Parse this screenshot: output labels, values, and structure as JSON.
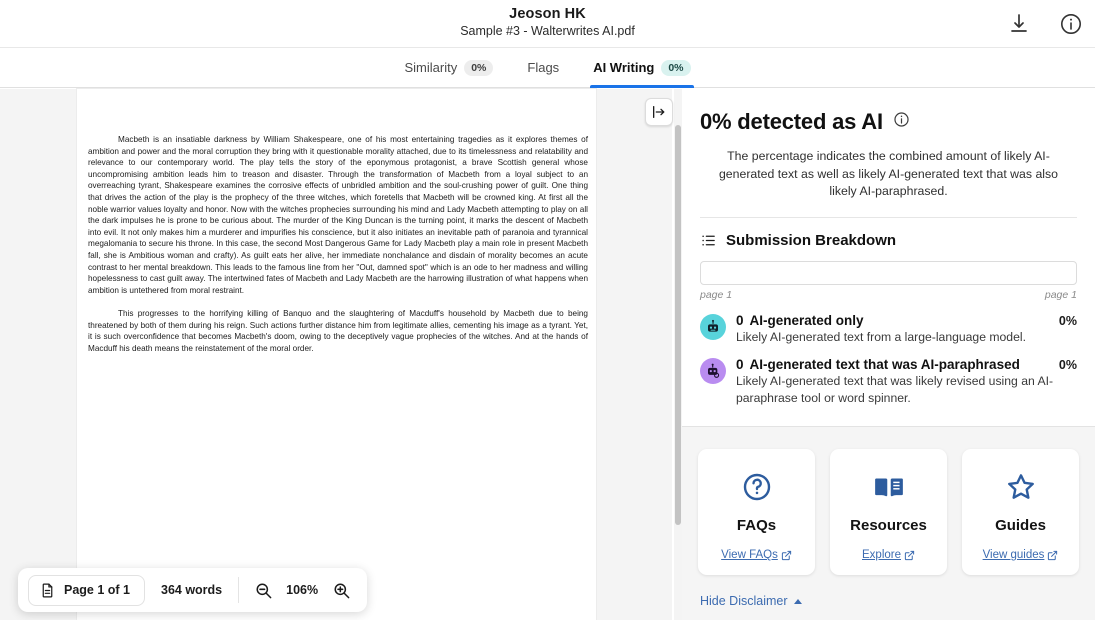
{
  "header": {
    "owner": "Jeoson HK",
    "document": "Sample #3 - Walterwrites AI.pdf",
    "download_icon": "download-icon",
    "info_icon": "info-icon"
  },
  "tabs": [
    {
      "label": "Similarity",
      "badge": "0%",
      "active": false
    },
    {
      "label": "Flags",
      "badge": "",
      "active": false
    },
    {
      "label": "AI Writing",
      "badge": "0%",
      "active": true
    }
  ],
  "viewer": {
    "collapse_button": "expand-panel-icon",
    "paragraphs": [
      "Macbeth is an insatiable darkness  by William Shakespeare, one of his most entertaining tragedies as it explores themes of ambition and power and the moral corruption they bring with it questionable morality attached, due to its timelessness and relatability and relevance to our contemporary world. The play tells the story of the eponymous protagonist, a brave Scottish general whose uncompromising  ambition leads him to treason and disaster. Through the transformation of Macbeth from a loyal subject to an overreaching tyrant, Shakespeare examines the corrosive  effects of unbridled ambition and the soul-crushing power of guilt. One thing that drives the action of the play is the prophecy of the three  witches, which foretells that Macbeth will be crowned king. At first all the noble warrior values  loyalty and honor. Now with the witches prophecies surrounding his mind  and Lady Macbeth attempting to play on all the dark impulses he is prone to be curious about. The murder of the King Duncan  is the turning point, it marks the descent of Macbeth into evil. It not only makes him  a murderer and impurifies his conscience, but it also initiates an inevitable path of paranoia and tyrannical megalomania to secure his throne. In this case, the second Most Dangerous Game for Lady Macbeth play a main role in present Macbeth fall, she is  Ambitious woman and crafty). As guilt eats  her alive, her immediate nonchalance and disdain of morality becomes an acute contrast to her mental breakdown. This leads to the famous line from her \"Out, damned spot\" which is  an ode to her madness and willing hopelessness to cast guilt away. The intertwined fates of Macbeth and Lady Macbeth are the harrowing illustration of what  happens when ambition is untethered from moral restraint.",
      "This progresses to the horrifying killing of Banquo and the slaughtering of Macduff's household by Macbeth due to being threatened by both of them during his  reign. Such actions further distance him from  legitimate allies, cementing his image as a tyrant. Yet, it is such overconfidence  that becomes Macbeth's doom, owing to the deceptively vague prophecies of the witches. And at the hands of Macduff his death  means the reinstatement of the moral order."
    ]
  },
  "bottom_toolbar": {
    "page_icon": "document-page-icon",
    "page_label": "Page 1 of 1",
    "word_count": "364 words",
    "zoom_out_icon": "zoom-out-icon",
    "zoom_level": "106%",
    "zoom_in_icon": "zoom-in-icon"
  },
  "panel": {
    "detected_title": "0% detected as AI",
    "detected_info_icon": "info-icon",
    "description": "The percentage indicates the combined amount of likely AI-generated text as well as likely AI-generated text that was also likely AI-paraphrased.",
    "breakdown_icon": "list-icon",
    "breakdown_title": "Submission Breakdown",
    "page_label_left": "page 1",
    "page_label_right": "page 1",
    "items": [
      {
        "icon": "robot-icon",
        "icon_color": "#58d3db",
        "count": "0",
        "label": "AI-generated only",
        "percent": "0%",
        "description": "Likely AI-generated text from a large-language model."
      },
      {
        "icon": "robot-paraphrase-icon",
        "icon_color": "#b98cf0",
        "count": "0",
        "label": "AI-generated text that was AI-paraphrased",
        "percent": "0%",
        "description": "Likely AI-generated text that was likely revised using an AI-paraphrase tool or word spinner."
      }
    ],
    "cards": [
      {
        "icon": "question-circle-icon",
        "title": "FAQs",
        "link": "View FAQs"
      },
      {
        "icon": "open-book-icon",
        "title": "Resources",
        "link": "Explore"
      },
      {
        "icon": "star-icon",
        "title": "Guides",
        "link": "View guides"
      }
    ],
    "hide_disclaimer": "Hide Disclaimer"
  },
  "colors": {
    "accent_blue": "#1a73e8",
    "link_blue": "#3c6bb0",
    "badge_active_bg": "#d9f2ef",
    "panel_bg": "#f5f5f5",
    "viewer_bg": "#f4f4f4"
  }
}
